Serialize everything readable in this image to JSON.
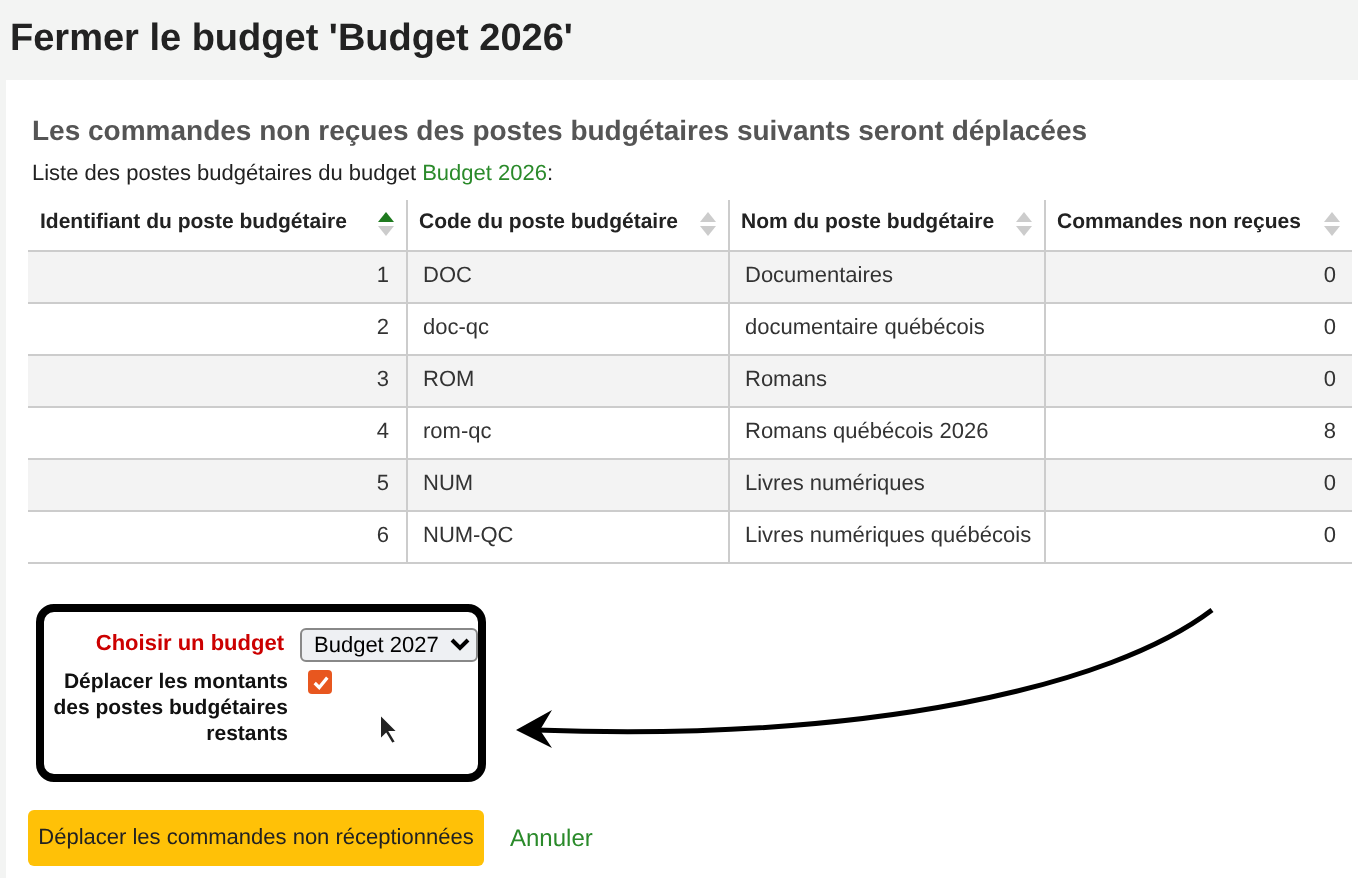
{
  "page_title": "Fermer le budget 'Budget 2026'",
  "section_heading": "Les commandes non reçues des postes budgétaires suivants seront déplacées",
  "intro": {
    "text": "Liste des postes budgétaires du budget ",
    "link": "Budget 2026",
    "suffix": ":"
  },
  "table": {
    "columns": [
      {
        "label": "Identifiant du poste budgétaire",
        "sorted": true
      },
      {
        "label": "Code du poste budgétaire",
        "sorted": false
      },
      {
        "label": "Nom du poste budgétaire",
        "sorted": false
      },
      {
        "label": "Commandes non reçues",
        "sorted": false
      }
    ],
    "rows": [
      [
        "1",
        "DOC",
        "Documentaires",
        "0"
      ],
      [
        "2",
        "doc-qc",
        "documentaire québécois",
        "0"
      ],
      [
        "3",
        "ROM",
        "Romans",
        "0"
      ],
      [
        "4",
        "rom-qc",
        "Romans québécois 2026",
        "8"
      ],
      [
        "5",
        "NUM",
        "Livres numériques",
        "0"
      ],
      [
        "6",
        "NUM-QC",
        "Livres numériques québécois",
        "0"
      ]
    ]
  },
  "form": {
    "budget_label": "Choisir un budget",
    "budget_value": "Budget 2027",
    "move_label": "Déplacer les montants des postes budgétaires restants",
    "move_checked": true
  },
  "submit_button": "Déplacer les commandes non réceptionnées",
  "cancel_link": "Annuler"
}
